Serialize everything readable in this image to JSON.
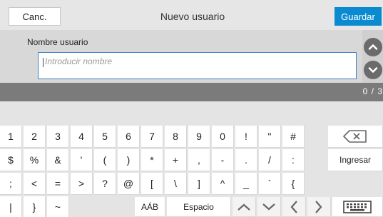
{
  "header": {
    "cancel_label": "Canc.",
    "title": "Nuevo usuario",
    "save_label": "Guardar"
  },
  "form": {
    "field_label": "Nombre usuario",
    "name_input": {
      "value": "",
      "placeholder": "Introducir nombre"
    },
    "counter": "0 / 3"
  },
  "keyboard": {
    "row1": [
      "1",
      "2",
      "3",
      "4",
      "5",
      "6",
      "7",
      "8",
      "9",
      "0",
      "!",
      "\"",
      "#"
    ],
    "row2": [
      "$",
      "%",
      "&",
      "'",
      "(",
      ")",
      "*",
      "+",
      ",",
      "-",
      ".",
      "/",
      ":"
    ],
    "row3": [
      ";",
      "<",
      "=",
      ">",
      "?",
      "@",
      "[",
      "\\",
      "]",
      "^",
      "_",
      "`",
      "{"
    ],
    "row4": [
      "|",
      "}",
      "~"
    ],
    "enter_label": "Ingresar",
    "accent_label": "AÁB",
    "space_label": "Espacio"
  },
  "icons": {
    "backspace": "backspace-icon",
    "scroll_up": "chevron-up-icon",
    "scroll_down": "chevron-down-icon",
    "up": "arrow-up-icon",
    "down": "arrow-down-icon",
    "left": "arrow-left-icon",
    "right": "arrow-right-icon",
    "keyboard": "keyboard-icon"
  },
  "colors": {
    "accent": "#0a8bd0",
    "input_border": "#3a83c8"
  }
}
